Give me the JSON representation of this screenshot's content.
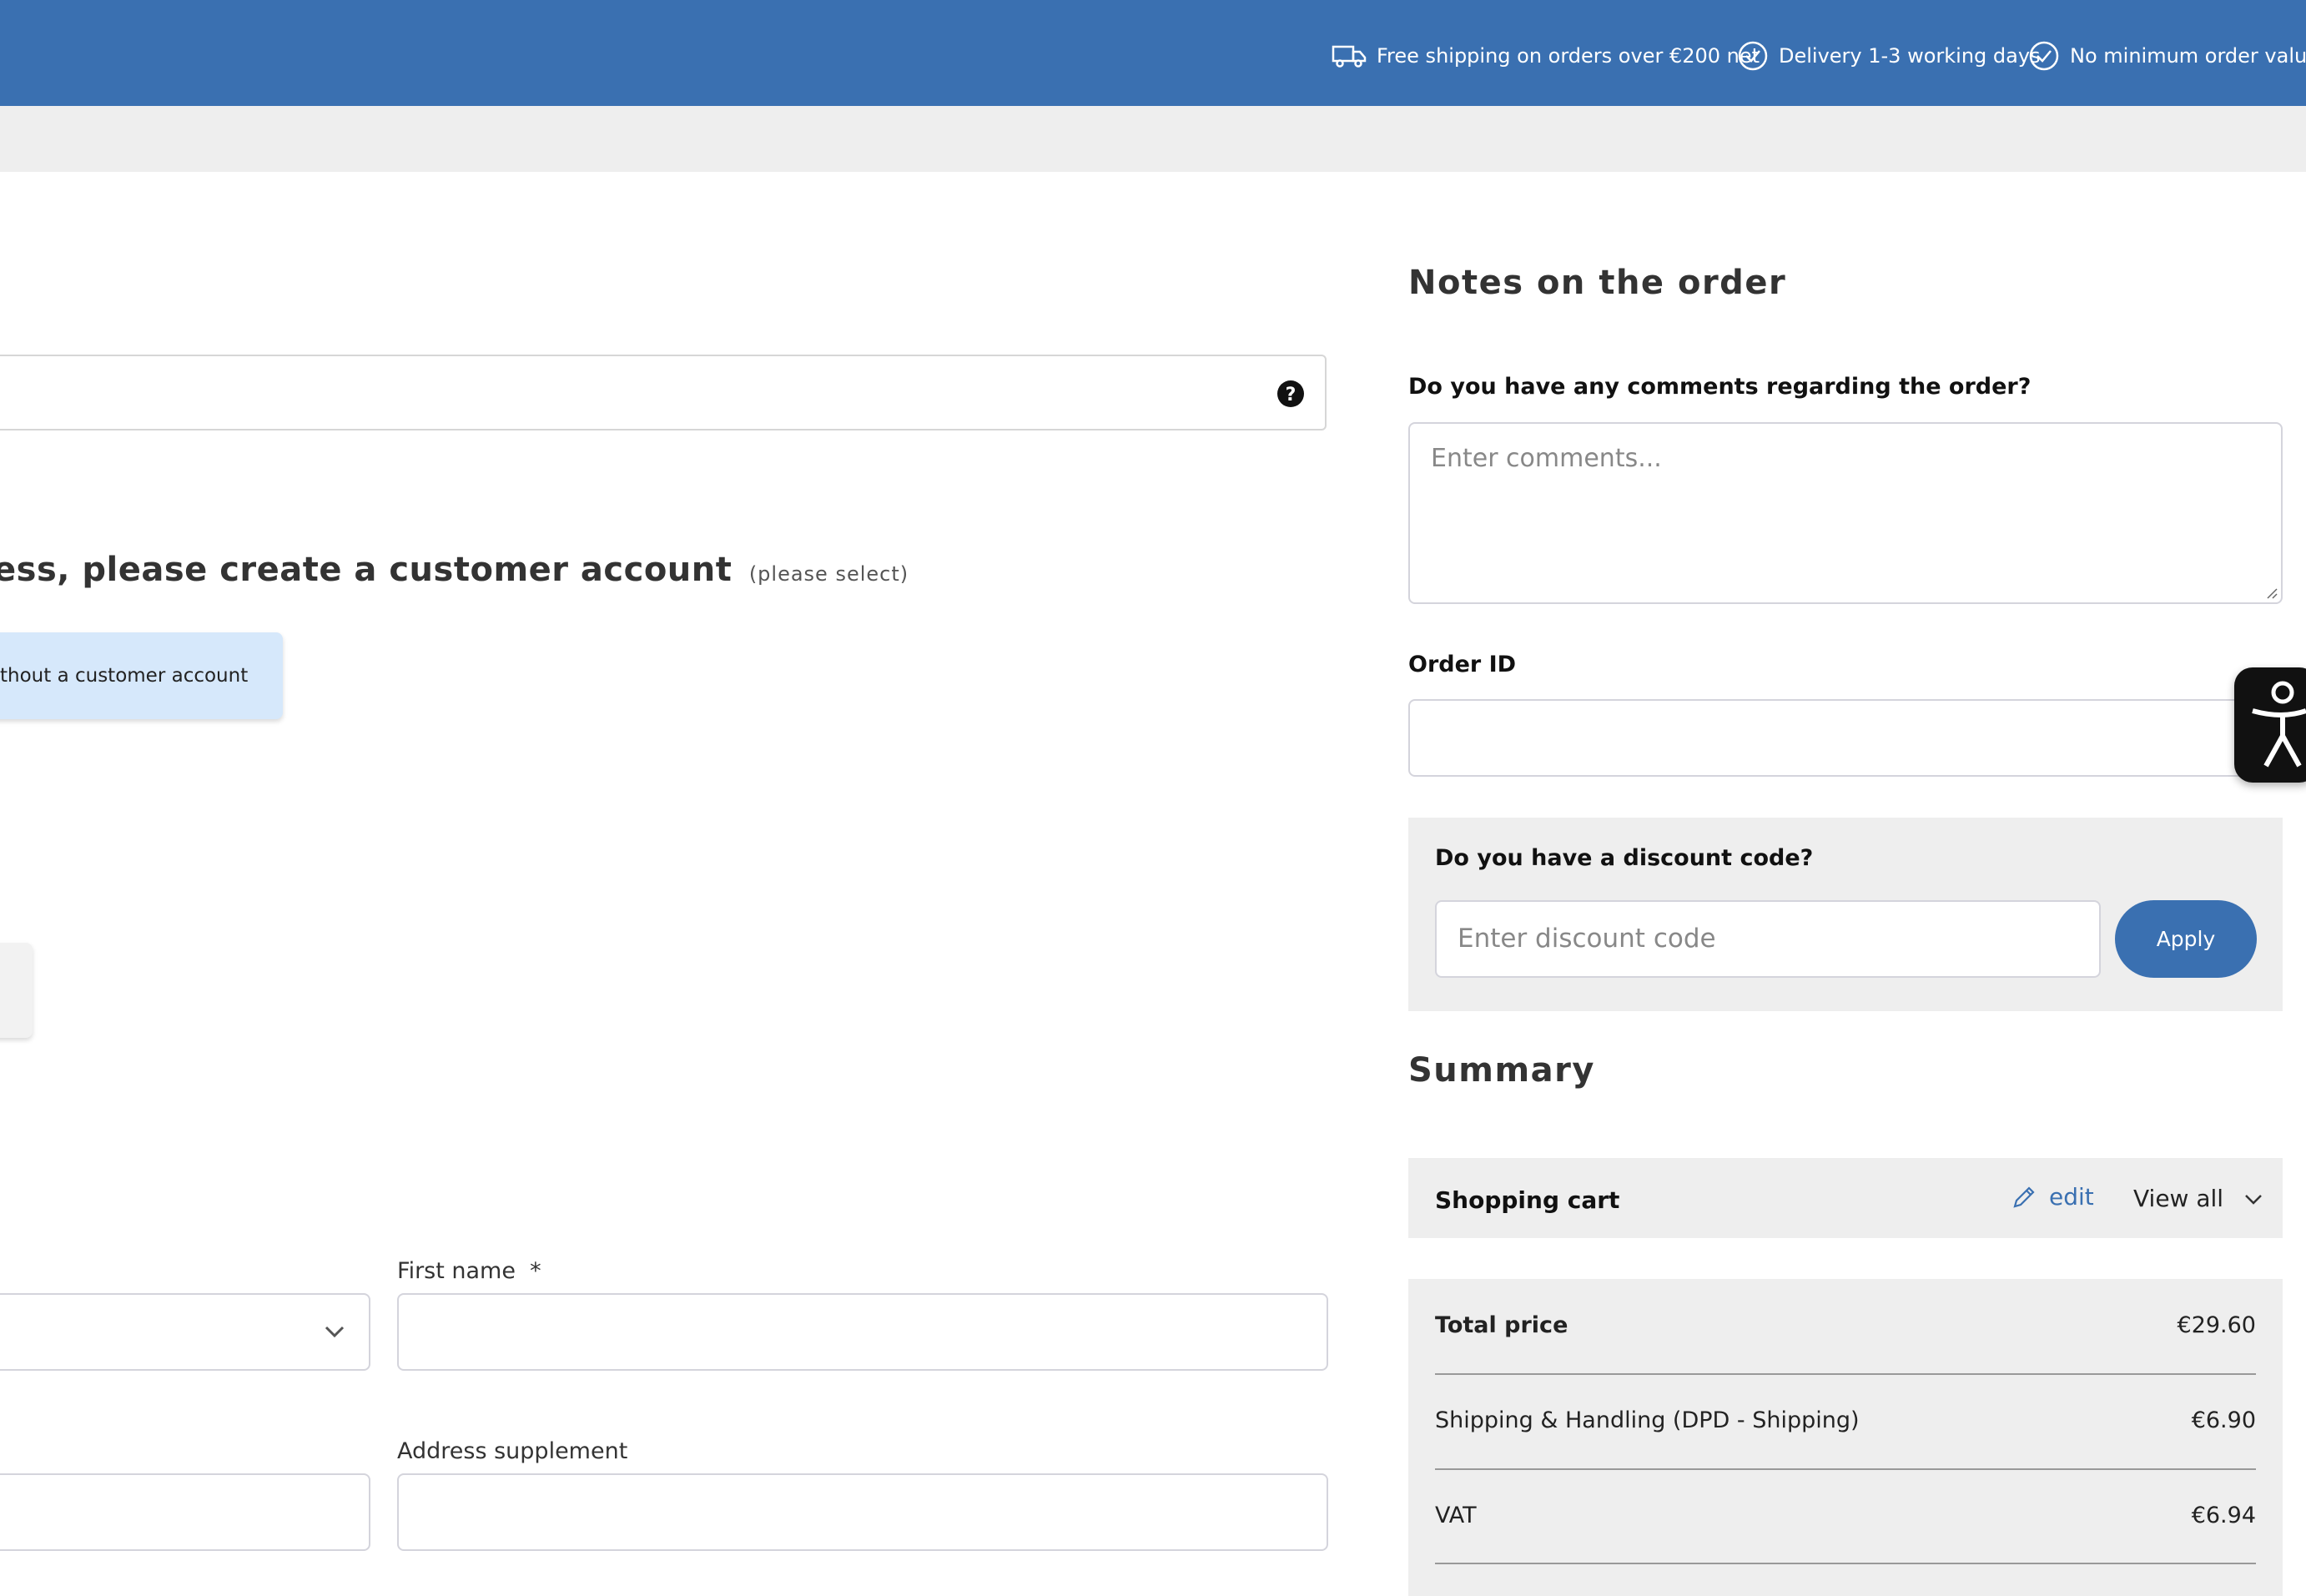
{
  "header": {
    "usps": [
      {
        "icon": "truck-icon",
        "text": "Free shipping on orders over €200 net"
      },
      {
        "icon": "check-circle-icon",
        "text": "Delivery 1-3 working days"
      },
      {
        "icon": "check-circle-icon",
        "text": "No minimum order value"
      }
    ]
  },
  "account": {
    "title": "ess, please create a customer account",
    "hint": "(please select)",
    "guest_option": "thout a customer account"
  },
  "form": {
    "first_name_label": "First name",
    "required_marker": "*",
    "address_supplement_label": "Address supplement"
  },
  "notes": {
    "heading": "Notes on the order",
    "comments_question": "Do you have any comments regarding the order?",
    "comments_placeholder": "Enter comments...",
    "order_id_label": "Order ID"
  },
  "discount": {
    "question": "Do you have a discount code?",
    "placeholder": "Enter discount code",
    "apply_label": "Apply"
  },
  "summary": {
    "heading": "Summary",
    "cart_label": "Shopping cart",
    "edit_label": "edit",
    "view_all_label": "View all",
    "rows": [
      {
        "label": "Total price",
        "value": "€29.60"
      },
      {
        "label": "Shipping & Handling (DPD - Shipping)",
        "value": "€6.90"
      },
      {
        "label": "VAT",
        "value": "€6.94"
      }
    ]
  },
  "colors": {
    "brand_blue": "#3a70b1",
    "guest_highlight": "#d6e8fb",
    "panel_gray": "#eeeeee"
  }
}
